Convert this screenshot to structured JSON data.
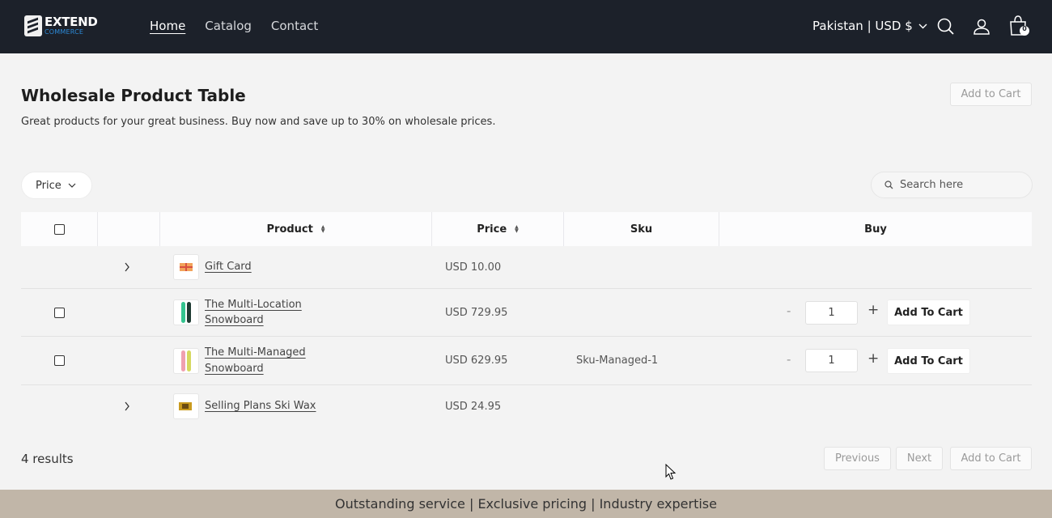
{
  "header": {
    "logo_line1": "EXTEND",
    "logo_line2": "COMMERCE",
    "nav": [
      {
        "label": "Home",
        "active": true
      },
      {
        "label": "Catalog",
        "active": false
      },
      {
        "label": "Contact",
        "active": false
      }
    ],
    "locale": "Pakistan | USD $",
    "cart_count": "0",
    "colors": {
      "bg": "#1c212a",
      "accent": "#2c8ad8"
    }
  },
  "page": {
    "title": "Wholesale Product Table",
    "subtitle": "Great products for your great business. Buy now and save up to 30% on wholesale prices.",
    "top_add_to_cart": "Add to Cart"
  },
  "filters": {
    "price_label": "Price",
    "search_placeholder": "Search here"
  },
  "table": {
    "columns": [
      "Product",
      "Price",
      "Sku",
      "Buy"
    ],
    "rows": [
      {
        "name": "Gift Card",
        "price": "USD 10.00",
        "sku": "",
        "expandable": true,
        "selectable": false
      },
      {
        "name": "The Multi-Location Snowboard",
        "price": "USD 729.95",
        "sku": "",
        "expandable": false,
        "selectable": true,
        "qty": "1",
        "button": "Add To Cart"
      },
      {
        "name": "The Multi-Managed Snowboard",
        "price": "USD 629.95",
        "sku": "Sku-Managed-1",
        "expandable": false,
        "selectable": true,
        "qty": "1",
        "button": "Add To Cart"
      },
      {
        "name": "Selling Plans Ski Wax",
        "price": "USD 24.95",
        "sku": "",
        "expandable": true,
        "selectable": false
      }
    ],
    "qty_minus": "-",
    "qty_plus": "+"
  },
  "pagination": {
    "results": "4 results",
    "previous": "Previous",
    "next": "Next",
    "add_to_cart": "Add to Cart"
  },
  "footer": {
    "text": "Outstanding service | Exclusive pricing | Industry expertise"
  },
  "icons": [
    "search-icon",
    "account-icon",
    "cart-icon",
    "chevron-down-icon",
    "sort-icon",
    "chevron-right-icon"
  ]
}
